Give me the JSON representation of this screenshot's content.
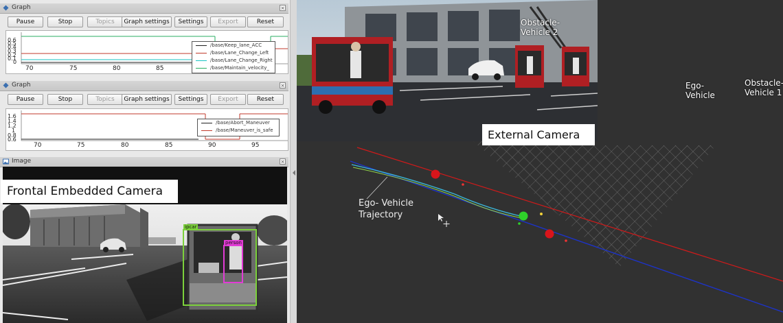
{
  "graph_panels": [
    {
      "title": "Graph",
      "toolbar": [
        "Pause",
        "Stop",
        "Topics",
        "Graph settings",
        "Settings",
        "Export",
        "Reset"
      ],
      "disabled": [
        "Topics",
        "Export"
      ],
      "x_ticks": [
        "70",
        "75",
        "80",
        "85"
      ],
      "y_ticks": [
        "0.6",
        "0.5",
        "0.4",
        "0.3",
        "0.2",
        "0.1",
        "0"
      ],
      "legend": [
        {
          "label": "/base/Keep_lane_ACC",
          "color": "#1f1f1f"
        },
        {
          "label": "/base/Lane_Change_Left",
          "color": "#c0392b"
        },
        {
          "label": "/base/Lane_Change_Right",
          "color": "#17c3c3"
        },
        {
          "label": "/base/Maintain_velocity_",
          "color": "#27ae60"
        }
      ]
    },
    {
      "title": "Graph",
      "toolbar": [
        "Pause",
        "Stop",
        "Topics",
        "Graph settings",
        "Settings",
        "Export",
        "Reset"
      ],
      "disabled": [
        "Topics",
        "Export"
      ],
      "x_ticks": [
        "70",
        "75",
        "80",
        "85",
        "90",
        "95"
      ],
      "y_ticks": [
        "1.6",
        "1.4",
        "1.2",
        "1",
        "0.8",
        "0.6"
      ],
      "legend": [
        {
          "label": "/base/Abort_Maneuver",
          "color": "#1f1f1f"
        },
        {
          "label": "/base/Maneuver_is_safe",
          "color": "#c0392b"
        }
      ]
    }
  ],
  "image_panel": {
    "title": "Image",
    "camera_label": "Frontal Embedded Camera",
    "detections": [
      {
        "label": "ipcar",
        "color": "#7cd13b"
      },
      {
        "label": "person",
        "color": "#e23bd6"
      }
    ]
  },
  "viewer": {
    "external_camera_label": "External Camera",
    "annotations": {
      "obstacle2": "Obstacle-\nVehicle 2",
      "ego": "Ego-\nVehicle",
      "obstacle1": "Obstacle-\nVehicle 1"
    },
    "trajectory_label": "Ego- Vehicle\nTrajectory",
    "colors": {
      "red_marker": "#d9151b",
      "green_marker": "#2fd12a",
      "red_line": "#d11a1a",
      "blue_line": "#1d33c8"
    }
  }
}
